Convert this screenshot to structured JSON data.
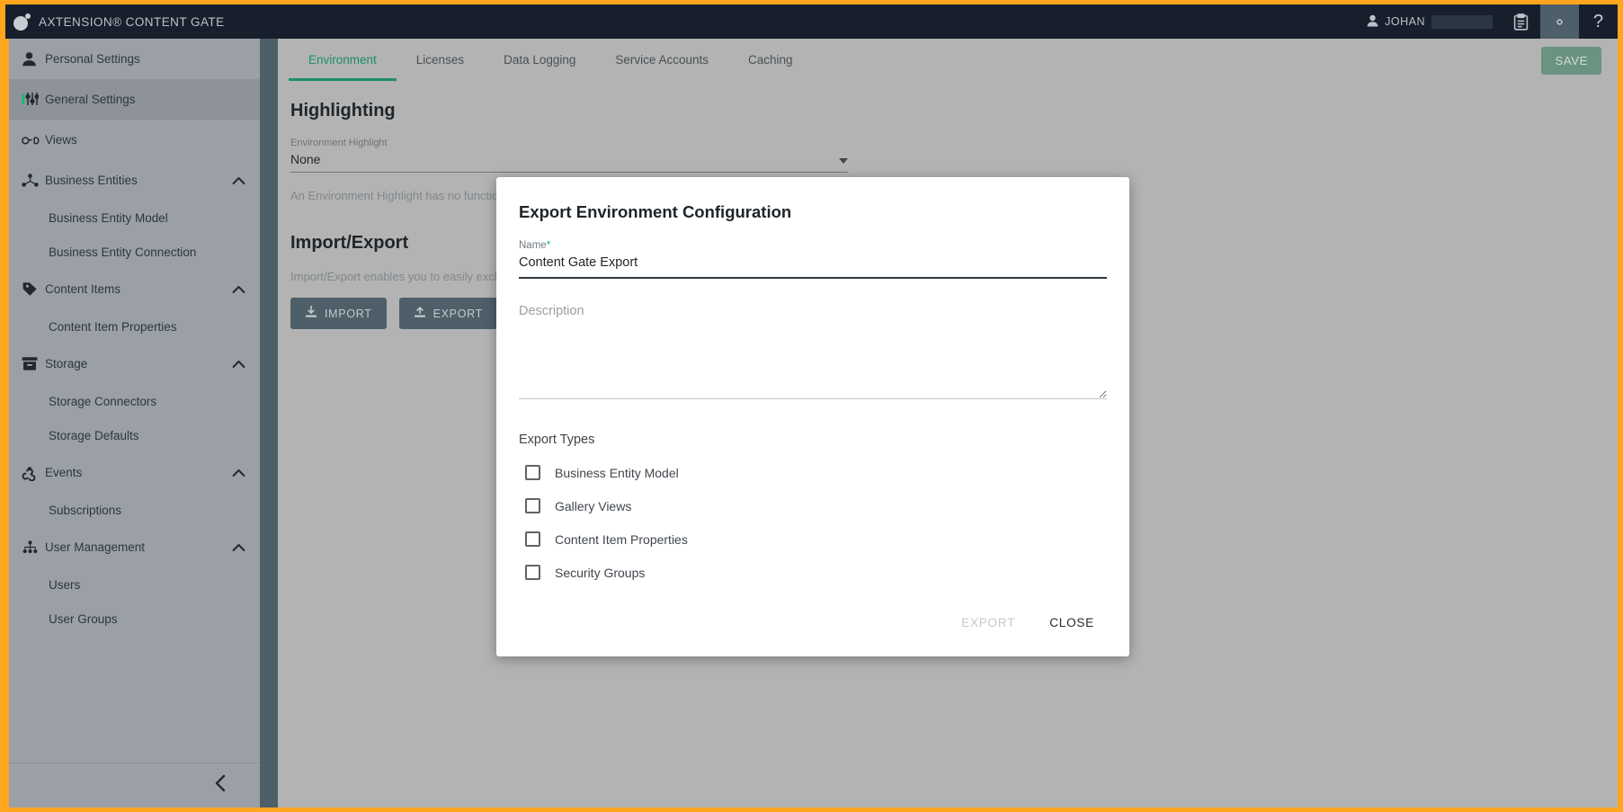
{
  "header": {
    "brand_title": "AXTENSION® CONTENT GATE",
    "logo_icon": "content-gate-logo-icon",
    "user_name": "JOHAN",
    "user_icon": "person-icon",
    "buttons": [
      {
        "name": "clipboard-icon",
        "label": ""
      },
      {
        "name": "gear-icon",
        "label": ""
      },
      {
        "name": "help-icon",
        "label": "?"
      }
    ]
  },
  "sidebar": {
    "items": [
      {
        "label": "Personal Settings",
        "icon": "person-icon",
        "level": "top",
        "selected": false,
        "expandable": false
      },
      {
        "label": "General Settings",
        "icon": "sliders-icon",
        "level": "top",
        "selected": true,
        "expandable": false
      },
      {
        "label": "Views",
        "icon": "glasses-icon",
        "level": "top",
        "selected": false,
        "expandable": false
      },
      {
        "label": "Business Entities",
        "icon": "hierarchy-icon",
        "level": "top",
        "selected": false,
        "expandable": true
      },
      {
        "label": "Business Entity Model",
        "icon": "",
        "level": "sub",
        "selected": false,
        "expandable": false
      },
      {
        "label": "Business Entity Connection",
        "icon": "",
        "level": "sub",
        "selected": false,
        "expandable": false
      },
      {
        "label": "Content Items",
        "icon": "tag-icon",
        "level": "top",
        "selected": false,
        "expandable": true
      },
      {
        "label": "Content Item Properties",
        "icon": "",
        "level": "sub",
        "selected": false,
        "expandable": false
      },
      {
        "label": "Storage",
        "icon": "archive-box-icon",
        "level": "top",
        "selected": false,
        "expandable": true
      },
      {
        "label": "Storage Connectors",
        "icon": "",
        "level": "sub",
        "selected": false,
        "expandable": false
      },
      {
        "label": "Storage Defaults",
        "icon": "",
        "level": "sub",
        "selected": false,
        "expandable": false
      },
      {
        "label": "Events",
        "icon": "webhook-icon",
        "level": "top",
        "selected": false,
        "expandable": true
      },
      {
        "label": "Subscriptions",
        "icon": "",
        "level": "sub",
        "selected": false,
        "expandable": false
      },
      {
        "label": "User Management",
        "icon": "users-group-icon",
        "level": "top",
        "selected": false,
        "expandable": true
      },
      {
        "label": "Users",
        "icon": "",
        "level": "sub",
        "selected": false,
        "expandable": false
      },
      {
        "label": "User Groups",
        "icon": "",
        "level": "sub",
        "selected": false,
        "expandable": false
      }
    ],
    "collapse_icon": "chevron-left-icon"
  },
  "main": {
    "tabs": [
      {
        "label": "Environment",
        "active": true
      },
      {
        "label": "Licenses",
        "active": false
      },
      {
        "label": "Data Logging",
        "active": false
      },
      {
        "label": "Service Accounts",
        "active": false
      },
      {
        "label": "Caching",
        "active": false
      }
    ],
    "save_label": "SAVE",
    "highlighting": {
      "title": "Highlighting",
      "field_label": "Environment Highlight",
      "field_value": "None",
      "helper_text": "An Environment Highlight has no function"
    },
    "import_export": {
      "title": "Import/Export",
      "description": "Import/Export enables you to easily excha",
      "import_label": "IMPORT",
      "import_icon": "download-icon",
      "export_label": "EXPORT",
      "export_icon": "upload-icon"
    }
  },
  "modal": {
    "title": "Export Environment Configuration",
    "name_label": "Name",
    "name_required_marker": "*",
    "name_value": "Content Gate Export",
    "description_placeholder": "Description",
    "description_value": "",
    "export_types_label": "Export Types",
    "export_types": [
      {
        "label": "Business Entity Model",
        "checked": false
      },
      {
        "label": "Gallery Views",
        "checked": false
      },
      {
        "label": "Content Item Properties",
        "checked": false
      },
      {
        "label": "Security Groups",
        "checked": false
      }
    ],
    "export_button": "EXPORT",
    "close_button": "CLOSE"
  },
  "colors": {
    "window_border": "#ffa51e",
    "header_bg": "#161f2b",
    "sidebar_bg": "#9aa0a6",
    "accent_green": "#1e8f64",
    "required_green": "#17b978",
    "frame_grey": "#4e5f69"
  }
}
